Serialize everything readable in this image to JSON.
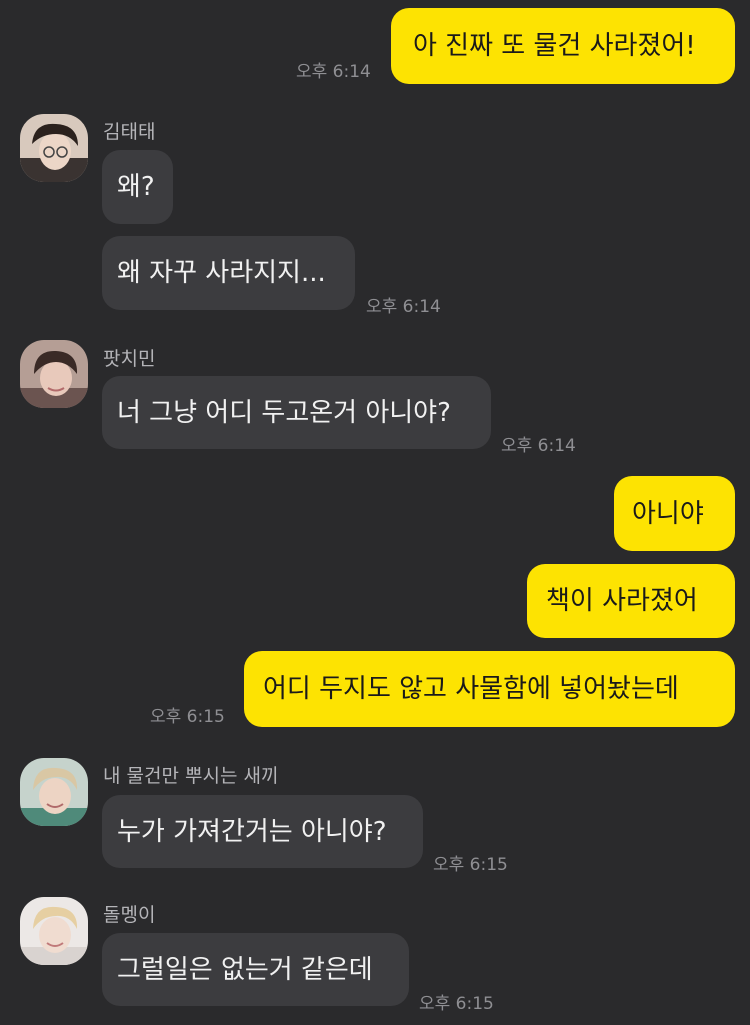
{
  "chat": {
    "messages": [
      {
        "text": "아 진짜 또 물건 사라졌어!",
        "time": "오후 6:14"
      },
      {
        "sender": "김태태",
        "text": "왜?"
      },
      {
        "text": "왜 자꾸 사라지지...",
        "time": "오후 6:14"
      },
      {
        "sender": "팟치민",
        "text": "너 그냥 어디 두고온거 아니야?",
        "time": "오후 6:14"
      },
      {
        "text": "아니야"
      },
      {
        "text": "책이 사라졌어"
      },
      {
        "text": "어디 두지도 않고 사물함에 넣어놨는데",
        "time": "오후 6:15"
      },
      {
        "sender": "내 물건만 뿌시는 새끼",
        "text": "누가 가져간거는 아니야?",
        "time": "오후 6:15"
      },
      {
        "sender": "돌멩이",
        "text": "그럴일은 없는거 같은데",
        "time": "오후 6:15"
      }
    ]
  },
  "theme": {
    "background": "#2a2a2c",
    "outgoing_bubble": "#fde302",
    "incoming_bubble": "#3c3c3f"
  },
  "icons": {
    "avatar": "profile-photo"
  }
}
